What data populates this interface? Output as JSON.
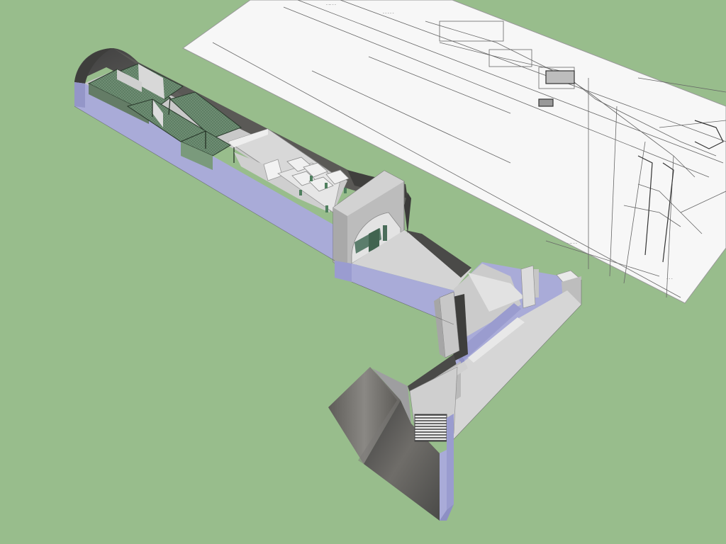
{
  "scene": {
    "colors": {
      "ground": "#98bd8c",
      "wall_light": "#a9abd8",
      "wall_mid": "#9496c8",
      "floor_light": "#d4d4d4",
      "floor_mid": "#bdbdbd",
      "rock_dark": "#4f4f4f",
      "rock_mid": "#6c6a66",
      "glass": "#5b7a62",
      "drawing_paper": "#f7f7f7",
      "drawing_line": "#555555"
    },
    "objects": [
      "bunker-tunnel",
      "arched-portal",
      "corridor",
      "l-shaped-wing",
      "entrance-stair-shaft",
      "floor-plan-drawing"
    ]
  }
}
